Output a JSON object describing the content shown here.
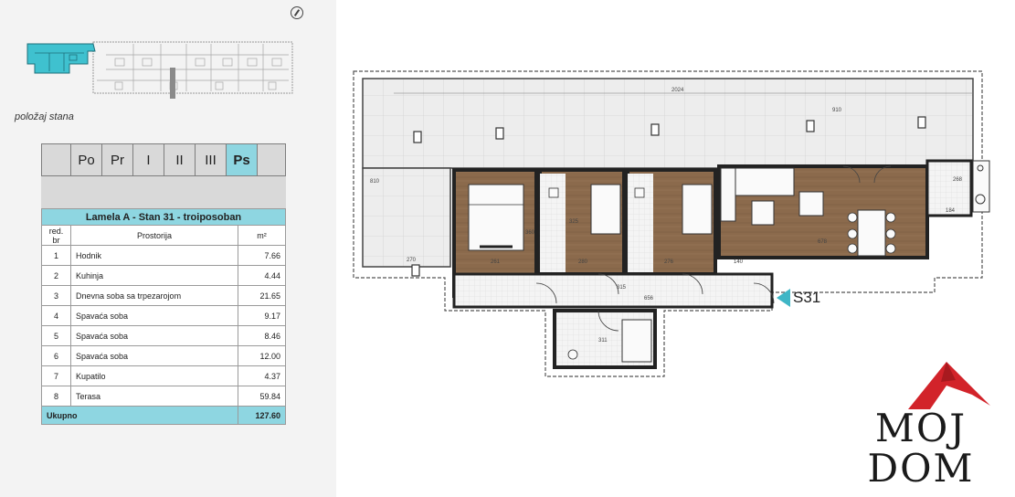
{
  "colors": {
    "accent": "#8ed6e1",
    "marker": "#3fb6c6",
    "wood": "#8b6a4c",
    "logo_red": "#d2232a"
  },
  "position_label": "položaj stana",
  "floor_tabs": {
    "items": [
      "Po",
      "Pr",
      "I",
      "II",
      "III",
      "Ps"
    ],
    "active": "Ps"
  },
  "table": {
    "caption": "Lamela A - Stan 31 - troiposoban",
    "headers": [
      "red. br",
      "Prostorija",
      "m²"
    ],
    "rows": [
      {
        "no": "1",
        "room": "Hodnik",
        "area": "7.66"
      },
      {
        "no": "2",
        "room": "Kuhinja",
        "area": "4.44"
      },
      {
        "no": "3",
        "room": "Dnevna soba sa trpezarojom",
        "area": "21.65"
      },
      {
        "no": "4",
        "room": "Spavaća soba",
        "area": "9.17"
      },
      {
        "no": "5",
        "room": "Spavaća soba",
        "area": "8.46"
      },
      {
        "no": "6",
        "room": "Spavaća soba",
        "area": "12.00"
      },
      {
        "no": "7",
        "room": "Kupatilo",
        "area": "4.37"
      },
      {
        "no": "8",
        "room": "Terasa",
        "area": "59.84"
      }
    ],
    "total_label": "Ukupno",
    "total_value": "127.60"
  },
  "plan": {
    "unit_label": "S31",
    "dimensions": {
      "terrace_width": "2024",
      "terrace_depth": "910",
      "left_depth": "810",
      "left_width": "270",
      "bed1": "261",
      "bed2": "280",
      "bed3": "276",
      "hall": "140",
      "living": "678",
      "corridor": "656",
      "corridor_depth": "315",
      "bath": "311",
      "kitchen": "268",
      "kitchen_depth": "184",
      "bed_height": "360",
      "bed2_height": "325"
    }
  },
  "logo": {
    "line1": "MOJ",
    "line2": "DOM"
  }
}
